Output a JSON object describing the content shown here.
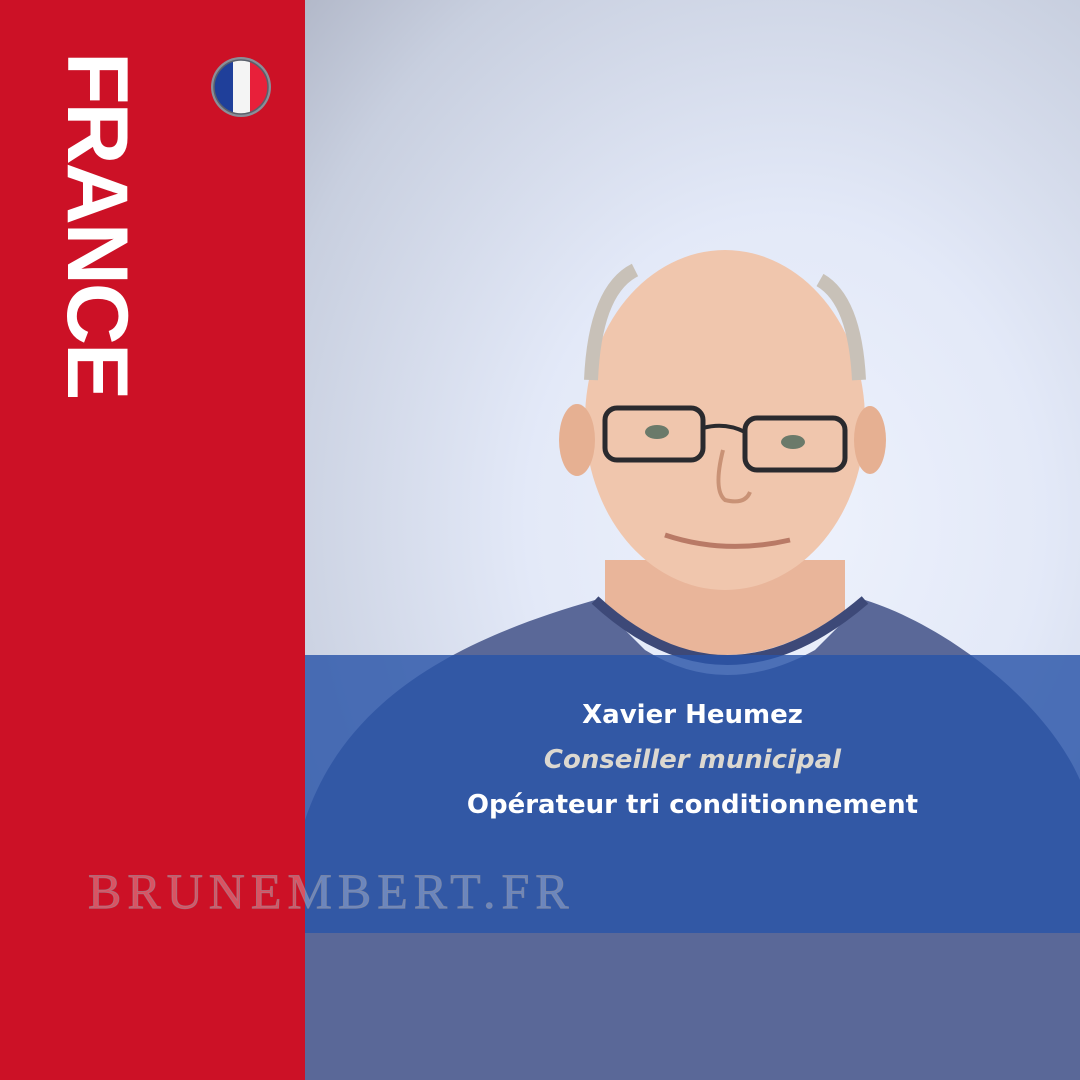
{
  "sidebar": {
    "country": "FRANCE",
    "flag_icon": "france-flag-icon",
    "colors": {
      "band": "#cc1126",
      "flag_blue": "#1f3f9a",
      "flag_red": "#e8203a"
    }
  },
  "photo": {
    "description_icon": "portrait-photo"
  },
  "caption": {
    "name": "Xavier Heumez",
    "role": "Conseiller municipal",
    "job": "Opérateur tri conditionnement",
    "band_color": "#2a54a8"
  },
  "watermark": {
    "text": "BRUNEMBERT.FR"
  }
}
